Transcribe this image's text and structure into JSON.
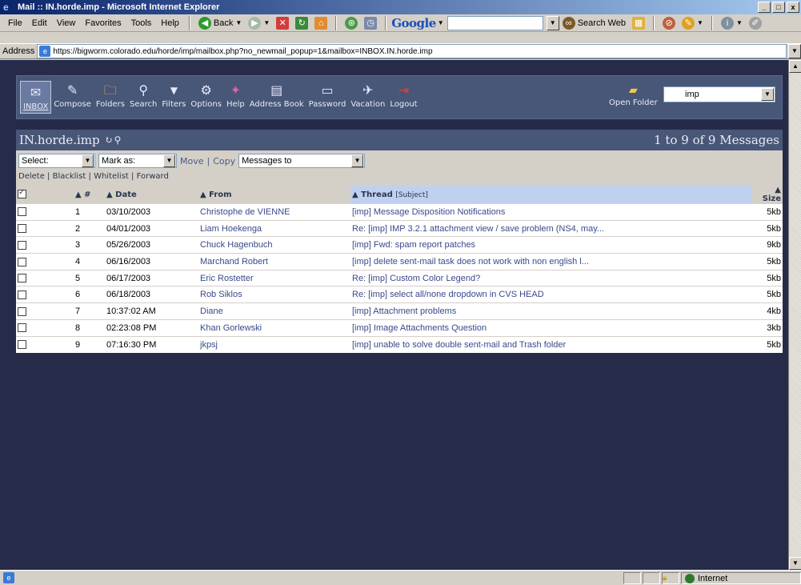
{
  "window": {
    "title": "Mail :: IN.horde.imp - Microsoft Internet Explorer",
    "controls": [
      "_",
      "□",
      "x"
    ]
  },
  "menu": [
    "File",
    "Edit",
    "View",
    "Favorites",
    "Tools",
    "Help"
  ],
  "toolbar": {
    "back_label": "Back",
    "google_label": "Google",
    "search_web_label": "Search Web"
  },
  "address": {
    "label": "Address",
    "url": "https://bigworm.colorado.edu/horde/imp/mailbox.php?no_newmail_popup=1&mailbox=INBOX.IN.horde.imp"
  },
  "nav": {
    "items": [
      {
        "label": "INBOX",
        "icon": "inbox-icon",
        "glyph": "✉"
      },
      {
        "label": "Compose",
        "icon": "compose-icon",
        "glyph": "✎"
      },
      {
        "label": "Folders",
        "icon": "folders-icon",
        "glyph": "🗀"
      },
      {
        "label": "Search",
        "icon": "search-icon",
        "glyph": "⚲"
      },
      {
        "label": "Filters",
        "icon": "filters-icon",
        "glyph": "▼"
      },
      {
        "label": "Options",
        "icon": "options-icon",
        "glyph": "⚙"
      },
      {
        "label": "Help",
        "icon": "help-icon",
        "glyph": "✦"
      },
      {
        "label": "Address Book",
        "icon": "address-book-icon",
        "glyph": "▤"
      },
      {
        "label": "Password",
        "icon": "password-icon",
        "glyph": "▭"
      },
      {
        "label": "Vacation",
        "icon": "vacation-icon",
        "glyph": "✈"
      },
      {
        "label": "Logout",
        "icon": "logout-icon",
        "glyph": "⇥"
      }
    ],
    "open_folder_label": "Open Folder",
    "folder_value": "imp"
  },
  "mailbox": {
    "name": "IN.horde.imp",
    "count_text": "1 to 9 of 9 Messages"
  },
  "controls": {
    "select_value": "Select:",
    "mark_as_value": "Mark as:",
    "move_label": "Move",
    "copy_label": "Copy",
    "messages_to_value": "Messages to",
    "actions": [
      "Delete",
      "Blacklist",
      "Whitelist",
      "Forward"
    ]
  },
  "table": {
    "headers": {
      "num": "▲ #",
      "date": "▲ Date",
      "from": "▲ From",
      "thread": "▲ Thread",
      "subject": "[Subject]",
      "size": "▲ Size"
    },
    "rows": [
      {
        "num": "1",
        "date": "03/10/2003",
        "from": "Christophe de VIENNE",
        "subject": "[imp] Message Disposition Notifications",
        "size": "5kb"
      },
      {
        "num": "2",
        "date": "04/01/2003",
        "from": "Liam Hoekenga",
        "subject": "Re: [imp] IMP 3.2.1 attachment view / save problem (NS4, may...",
        "size": "5kb"
      },
      {
        "num": "3",
        "date": "05/26/2003",
        "from": "Chuck Hagenbuch",
        "subject": "[imp] Fwd: spam report patches",
        "size": "9kb"
      },
      {
        "num": "4",
        "date": "06/16/2003",
        "from": "Marchand Robert",
        "subject": "[imp] delete sent-mail task does not work with non english l...",
        "size": "5kb"
      },
      {
        "num": "5",
        "date": "06/17/2003",
        "from": "Eric Rostetter",
        "subject": "Re: [imp] Custom Color Legend?",
        "size": "5kb"
      },
      {
        "num": "6",
        "date": "06/18/2003",
        "from": "Rob Siklos",
        "subject": "Re: [imp] select all/none dropdown in CVS HEAD",
        "size": "5kb"
      },
      {
        "num": "7",
        "date": "10:37:02 AM",
        "from": "Diane",
        "subject": "[imp] Attachment problems",
        "size": "4kb"
      },
      {
        "num": "8",
        "date": "02:23:08 PM",
        "from": "Khan Gorlewski",
        "subject": "[imp] Image Attachments Question",
        "size": "3kb"
      },
      {
        "num": "9",
        "date": "07:16:30 PM",
        "from": "jkpsj",
        "subject": "[imp] unable to solve double sent-mail and Trash folder",
        "size": "5kb"
      }
    ]
  },
  "status": {
    "zone_label": "Internet"
  }
}
